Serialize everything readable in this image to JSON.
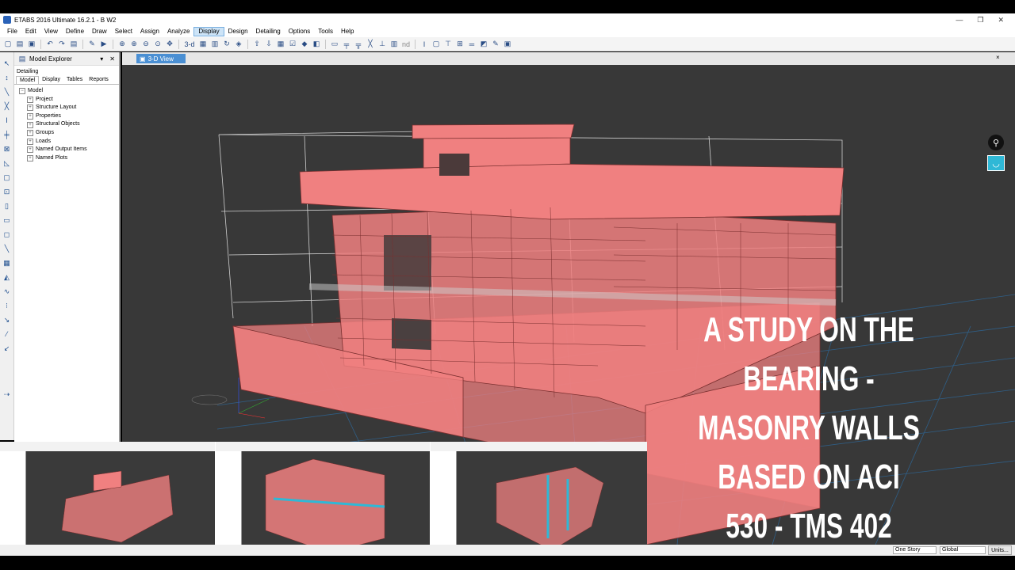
{
  "window": {
    "title": "ETABS 2016 Ultimate 16.2.1 - B W2",
    "controls": [
      "—",
      "❐",
      "✕"
    ]
  },
  "menu": [
    "File",
    "Edit",
    "View",
    "Define",
    "Draw",
    "Select",
    "Assign",
    "Analyze",
    "Display",
    "Design",
    "Detailing",
    "Options",
    "Tools",
    "Help"
  ],
  "menu_active": "Display",
  "toolbar_icons": [
    "new-file-icon",
    "open-folder-icon",
    "save-icon",
    "undo-icon",
    "redo-icon",
    "lock-icon",
    "pencil-icon",
    "run-icon",
    "zoom-rect-icon",
    "zoom-in-icon",
    "zoom-out-icon",
    "zoom-fit-icon",
    "pan-icon",
    "3d-view-icon",
    "plan-view-icon",
    "elevation-view-icon",
    "rotate-icon",
    "move-up-icon",
    "move-down-icon",
    "display-options-icon"
  ],
  "toolbar_text": {
    "three_d": "3-d",
    "nd": "nd"
  },
  "explorer": {
    "title": "Model Explorer",
    "pin": "▾",
    "close": "✕",
    "subtitle": "Detailing",
    "tabs": [
      "Model",
      "Display",
      "Tables",
      "Reports"
    ],
    "selected_tab": "Model",
    "root": "Model",
    "items": [
      "Project",
      "Structure Layout",
      "Properties",
      "Structural Objects",
      "Groups",
      "Loads",
      "Named Output Items",
      "Named Plots"
    ]
  },
  "view_tab": {
    "label": "3-D View",
    "close": "×"
  },
  "overlay_text": [
    "A STUDY ON THE BEARING -",
    "MASONRY WALLS",
    "BASED ON ACI",
    "530 - TMS 402"
  ],
  "status": {
    "story": "One Story",
    "coord": "Global",
    "units": "Units..."
  },
  "colors": {
    "viewport_bg": "#383838",
    "wall_fill": "#f08080",
    "wall_edge": "#7a2f2f",
    "grid": "#2c6fa8",
    "overlay_text": "#ffffff",
    "active_tab": "#4a8fd3"
  }
}
